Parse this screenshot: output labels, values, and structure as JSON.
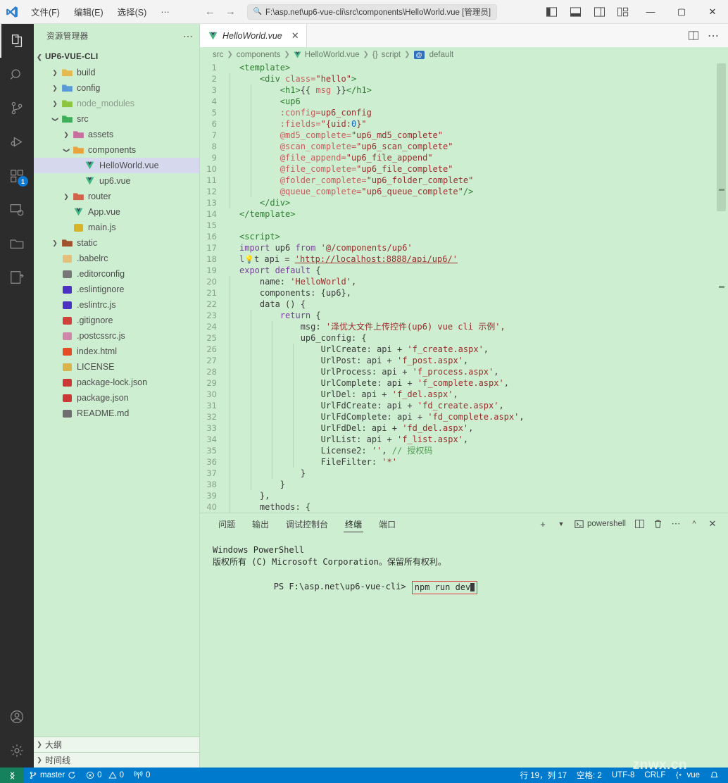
{
  "titlebar": {
    "menus": [
      "文件(F)",
      "编辑(E)",
      "选择(S)",
      "···"
    ],
    "search_path": "F:\\asp.net\\up6-vue-cli\\src\\components\\HelloWorld.vue [管理员]",
    "search_icon": "search-icon",
    "layout_icons": [
      "toggle-primary-sidebar-icon",
      "toggle-panel-icon",
      "toggle-secondary-sidebar-icon",
      "customize-layout-icon"
    ],
    "window_controls": {
      "minimize": "—",
      "maximize": "▢",
      "close": "✕"
    }
  },
  "activity_bar": {
    "items": [
      {
        "name": "explorer",
        "icon": "files-icon",
        "active": true,
        "badge": ""
      },
      {
        "name": "search",
        "icon": "search-icon",
        "active": false,
        "badge": ""
      },
      {
        "name": "source-control",
        "icon": "source-control-icon",
        "active": false,
        "badge": ""
      },
      {
        "name": "run-and-debug",
        "icon": "run-debug-icon",
        "active": false,
        "badge": ""
      },
      {
        "name": "extensions",
        "icon": "extensions-icon",
        "active": false,
        "badge": "1"
      },
      {
        "name": "remote-explorer",
        "icon": "remote-explorer-icon",
        "active": false,
        "badge": ""
      },
      {
        "name": "project-manager",
        "icon": "folder-icon",
        "active": false,
        "badge": ""
      },
      {
        "name": "code-runner",
        "icon": "code-snippet-icon",
        "active": false,
        "badge": ""
      }
    ],
    "bottom": [
      {
        "name": "accounts",
        "icon": "account-icon"
      },
      {
        "name": "manage",
        "icon": "gear-icon"
      }
    ]
  },
  "sidebar": {
    "title": "资源管理器",
    "more_icon": "more-actions-icon",
    "root": "UP6-VUE-CLI",
    "tree": [
      {
        "label": "build",
        "depth": 1,
        "type": "folder",
        "expanded": false,
        "icon": "folder-build-icon",
        "color": "#e6b94e"
      },
      {
        "label": "config",
        "depth": 1,
        "type": "folder",
        "expanded": false,
        "icon": "folder-config-icon",
        "color": "#5a9bd5"
      },
      {
        "label": "node_modules",
        "depth": 1,
        "type": "folder",
        "expanded": false,
        "icon": "folder-node-icon",
        "color": "#8cc63f"
      },
      {
        "label": "src",
        "depth": 1,
        "type": "folder",
        "expanded": true,
        "icon": "folder-src-icon",
        "color": "#3fae5a"
      },
      {
        "label": "assets",
        "depth": 2,
        "type": "folder",
        "expanded": false,
        "icon": "folder-assets-icon",
        "color": "#c96fa0"
      },
      {
        "label": "components",
        "depth": 2,
        "type": "folder",
        "expanded": true,
        "icon": "folder-components-icon",
        "color": "#e8a33d"
      },
      {
        "label": "HelloWorld.vue",
        "depth": 3,
        "type": "file",
        "selected": true,
        "icon": "vue-file-icon",
        "color": "#41b883"
      },
      {
        "label": "up6.vue",
        "depth": 3,
        "type": "file",
        "selected": false,
        "icon": "vue-file-icon",
        "color": "#41b883"
      },
      {
        "label": "router",
        "depth": 2,
        "type": "folder",
        "expanded": false,
        "icon": "folder-router-icon",
        "color": "#d1634b"
      },
      {
        "label": "App.vue",
        "depth": 2,
        "type": "file",
        "selected": false,
        "icon": "vue-file-icon",
        "color": "#41b883"
      },
      {
        "label": "main.js",
        "depth": 2,
        "type": "file",
        "selected": false,
        "icon": "js-file-icon",
        "color": "#d6b429"
      },
      {
        "label": "static",
        "depth": 1,
        "type": "folder",
        "expanded": false,
        "icon": "folder-static-icon",
        "color": "#a0522d"
      },
      {
        "label": ".babelrc",
        "depth": 1,
        "type": "file",
        "selected": false,
        "icon": "babel-file-icon",
        "color": "#e5c07b"
      },
      {
        "label": ".editorconfig",
        "depth": 1,
        "type": "file",
        "selected": false,
        "icon": "editorconfig-file-icon",
        "color": "#777777"
      },
      {
        "label": ".eslintignore",
        "depth": 1,
        "type": "file",
        "selected": false,
        "icon": "eslint-file-icon",
        "color": "#4b32c3"
      },
      {
        "label": ".eslintrc.js",
        "depth": 1,
        "type": "file",
        "selected": false,
        "icon": "eslint-file-icon",
        "color": "#4b32c3"
      },
      {
        "label": ".gitignore",
        "depth": 1,
        "type": "file",
        "selected": false,
        "icon": "git-file-icon",
        "color": "#d1403a"
      },
      {
        "label": ".postcssrc.js",
        "depth": 1,
        "type": "file",
        "selected": false,
        "icon": "postcss-file-icon",
        "color": "#d086a8"
      },
      {
        "label": "index.html",
        "depth": 1,
        "type": "file",
        "selected": false,
        "icon": "html-file-icon",
        "color": "#e44d26"
      },
      {
        "label": "LICENSE",
        "depth": 1,
        "type": "file",
        "selected": false,
        "icon": "license-file-icon",
        "color": "#d8b44a"
      },
      {
        "label": "package-lock.json",
        "depth": 1,
        "type": "file",
        "selected": false,
        "icon": "npm-file-icon",
        "color": "#cb3837"
      },
      {
        "label": "package.json",
        "depth": 1,
        "type": "file",
        "selected": false,
        "icon": "npm-file-icon",
        "color": "#cb3837"
      },
      {
        "label": "README.md",
        "depth": 1,
        "type": "file",
        "selected": false,
        "icon": "markdown-file-icon",
        "color": "#6f6f6f"
      }
    ],
    "sections": [
      {
        "label": "大纲"
      },
      {
        "label": "时间线"
      }
    ]
  },
  "editor": {
    "tab": {
      "label": "HelloWorld.vue",
      "icon": "vue-file-icon",
      "close_icon": "close-icon"
    },
    "tab_actions": [
      "split-editor-icon",
      "more-actions-icon"
    ],
    "breadcrumb": [
      "src",
      "components",
      "HelloWorld.vue",
      "script",
      "default"
    ],
    "breadcrumb_badges": {
      "script": "{}",
      "default": "@"
    },
    "lines": [
      {
        "n": 1,
        "tokens": [
          {
            "t": "<template>",
            "c": "t-tag"
          }
        ],
        "indent": 0
      },
      {
        "n": 2,
        "tokens": [
          {
            "t": "<div ",
            "c": "t-tag"
          },
          {
            "t": "class=",
            "c": "t-attr"
          },
          {
            "t": "\"hello\"",
            "c": "t-str"
          },
          {
            "t": ">",
            "c": "t-tag"
          }
        ],
        "indent": 1
      },
      {
        "n": 3,
        "tokens": [
          {
            "t": "<h1>",
            "c": "t-tag"
          },
          {
            "t": "{{ ",
            "c": "t-punc"
          },
          {
            "t": "msg",
            "c": "t-attr"
          },
          {
            "t": " }}",
            "c": "t-punc"
          },
          {
            "t": "</h1>",
            "c": "t-tag"
          }
        ],
        "indent": 2
      },
      {
        "n": 4,
        "tokens": [
          {
            "t": "<up6",
            "c": "t-tag"
          }
        ],
        "indent": 2
      },
      {
        "n": 5,
        "tokens": [
          {
            "t": ":config=",
            "c": "t-attr"
          },
          {
            "t": "up6_config",
            "c": "t-str"
          }
        ],
        "indent": 2
      },
      {
        "n": 6,
        "tokens": [
          {
            "t": ":fields=",
            "c": "t-attr"
          },
          {
            "t": "\"{uid:",
            "c": "t-str"
          },
          {
            "t": "0",
            "c": "t-num"
          },
          {
            "t": "}\"",
            "c": "t-str"
          }
        ],
        "indent": 2
      },
      {
        "n": 7,
        "tokens": [
          {
            "t": "@md5_complete=",
            "c": "t-attr"
          },
          {
            "t": "\"up6_md5_complete\"",
            "c": "t-str"
          }
        ],
        "indent": 2
      },
      {
        "n": 8,
        "tokens": [
          {
            "t": "@scan_complete=",
            "c": "t-attr"
          },
          {
            "t": "\"up6_scan_complete\"",
            "c": "t-str"
          }
        ],
        "indent": 2
      },
      {
        "n": 9,
        "tokens": [
          {
            "t": "@file_append=",
            "c": "t-attr"
          },
          {
            "t": "\"up6_file_append\"",
            "c": "t-str"
          }
        ],
        "indent": 2
      },
      {
        "n": 10,
        "tokens": [
          {
            "t": "@file_complete=",
            "c": "t-attr"
          },
          {
            "t": "\"up6_file_complete\"",
            "c": "t-str"
          }
        ],
        "indent": 2
      },
      {
        "n": 11,
        "tokens": [
          {
            "t": "@folder_complete=",
            "c": "t-attr"
          },
          {
            "t": "\"up6_folder_complete\"",
            "c": "t-str"
          }
        ],
        "indent": 2
      },
      {
        "n": 12,
        "tokens": [
          {
            "t": "@queue_complete=",
            "c": "t-attr"
          },
          {
            "t": "\"up6_queue_complete\"",
            "c": "t-str"
          },
          {
            "t": "/>",
            "c": "t-tag"
          }
        ],
        "indent": 2
      },
      {
        "n": 13,
        "tokens": [
          {
            "t": "</div>",
            "c": "t-tag"
          }
        ],
        "indent": 1
      },
      {
        "n": 14,
        "tokens": [
          {
            "t": "</template>",
            "c": "t-tag"
          }
        ],
        "indent": 0
      },
      {
        "n": 15,
        "tokens": [],
        "indent": 0
      },
      {
        "n": 16,
        "tokens": [
          {
            "t": "<script>",
            "c": "t-tag"
          }
        ],
        "indent": 0
      },
      {
        "n": 17,
        "tokens": [
          {
            "t": "import",
            "c": "t-kw2"
          },
          {
            "t": " up6 ",
            "c": "t-plain"
          },
          {
            "t": "from",
            "c": "t-kw2"
          },
          {
            "t": " '@/components/up6'",
            "c": "t-str"
          }
        ],
        "indent": 0
      },
      {
        "n": 18,
        "tokens": [
          {
            "t": "l",
            "c": "t-kw2"
          },
          {
            "t": "💡",
            "c": "bulb"
          },
          {
            "t": "t api = ",
            "c": "t-plain"
          },
          {
            "t": "'http://localhost:8888/api/up6/'",
            "c": "t-link"
          }
        ],
        "indent": 0
      },
      {
        "n": 19,
        "tokens": [
          {
            "t": "export default",
            "c": "t-kw2"
          },
          {
            "t": " {",
            "c": "t-punc"
          }
        ],
        "indent": 0
      },
      {
        "n": 20,
        "tokens": [
          {
            "t": "name: ",
            "c": "t-plain"
          },
          {
            "t": "'HelloWorld'",
            "c": "t-str"
          },
          {
            "t": ",",
            "c": "t-punc"
          }
        ],
        "indent": 1
      },
      {
        "n": 21,
        "tokens": [
          {
            "t": "components: {up6},",
            "c": "t-plain"
          }
        ],
        "indent": 1
      },
      {
        "n": 22,
        "tokens": [
          {
            "t": "data () {",
            "c": "t-plain"
          }
        ],
        "indent": 1
      },
      {
        "n": 23,
        "tokens": [
          {
            "t": "return",
            "c": "t-kw2"
          },
          {
            "t": " {",
            "c": "t-punc"
          }
        ],
        "indent": 2
      },
      {
        "n": 24,
        "tokens": [
          {
            "t": "msg: ",
            "c": "t-plain"
          },
          {
            "t": "'泽优大文件上传控件(up6) vue cli 示例',",
            "c": "t-str"
          }
        ],
        "indent": 3
      },
      {
        "n": 25,
        "tokens": [
          {
            "t": "up6_config: {",
            "c": "t-plain"
          }
        ],
        "indent": 3
      },
      {
        "n": 26,
        "tokens": [
          {
            "t": "UrlCreate: api + ",
            "c": "t-plain"
          },
          {
            "t": "'f_create.aspx'",
            "c": "t-str"
          },
          {
            "t": ",",
            "c": "t-punc"
          }
        ],
        "indent": 4
      },
      {
        "n": 27,
        "tokens": [
          {
            "t": "UrlPost: api + ",
            "c": "t-plain"
          },
          {
            "t": "'f_post.aspx'",
            "c": "t-str"
          },
          {
            "t": ",",
            "c": "t-punc"
          }
        ],
        "indent": 4
      },
      {
        "n": 28,
        "tokens": [
          {
            "t": "UrlProcess: api + ",
            "c": "t-plain"
          },
          {
            "t": "'f_process.aspx'",
            "c": "t-str"
          },
          {
            "t": ",",
            "c": "t-punc"
          }
        ],
        "indent": 4
      },
      {
        "n": 29,
        "tokens": [
          {
            "t": "UrlComplete: api + ",
            "c": "t-plain"
          },
          {
            "t": "'f_complete.aspx'",
            "c": "t-str"
          },
          {
            "t": ",",
            "c": "t-punc"
          }
        ],
        "indent": 4
      },
      {
        "n": 30,
        "tokens": [
          {
            "t": "UrlDel: api + ",
            "c": "t-plain"
          },
          {
            "t": "'f_del.aspx'",
            "c": "t-str"
          },
          {
            "t": ",",
            "c": "t-punc"
          }
        ],
        "indent": 4
      },
      {
        "n": 31,
        "tokens": [
          {
            "t": "UrlFdCreate: api + ",
            "c": "t-plain"
          },
          {
            "t": "'fd_create.aspx'",
            "c": "t-str"
          },
          {
            "t": ",",
            "c": "t-punc"
          }
        ],
        "indent": 4
      },
      {
        "n": 32,
        "tokens": [
          {
            "t": "UrlFdComplete: api + ",
            "c": "t-plain"
          },
          {
            "t": "'fd_complete.aspx'",
            "c": "t-str"
          },
          {
            "t": ",",
            "c": "t-punc"
          }
        ],
        "indent": 4
      },
      {
        "n": 33,
        "tokens": [
          {
            "t": "UrlFdDel: api + ",
            "c": "t-plain"
          },
          {
            "t": "'fd_del.aspx'",
            "c": "t-str"
          },
          {
            "t": ",",
            "c": "t-punc"
          }
        ],
        "indent": 4
      },
      {
        "n": 34,
        "tokens": [
          {
            "t": "UrlList: api + ",
            "c": "t-plain"
          },
          {
            "t": "'f_list.aspx'",
            "c": "t-str"
          },
          {
            "t": ",",
            "c": "t-punc"
          }
        ],
        "indent": 4
      },
      {
        "n": 35,
        "tokens": [
          {
            "t": "License2: ",
            "c": "t-plain"
          },
          {
            "t": "''",
            "c": "t-str"
          },
          {
            "t": ", ",
            "c": "t-punc"
          },
          {
            "t": "// 授权码",
            "c": "t-com"
          }
        ],
        "indent": 4
      },
      {
        "n": 36,
        "tokens": [
          {
            "t": "FileFilter: ",
            "c": "t-plain"
          },
          {
            "t": "'*'",
            "c": "t-str"
          }
        ],
        "indent": 4
      },
      {
        "n": 37,
        "tokens": [
          {
            "t": "}",
            "c": "t-punc"
          }
        ],
        "indent": 3
      },
      {
        "n": 38,
        "tokens": [
          {
            "t": "}",
            "c": "t-punc"
          }
        ],
        "indent": 2
      },
      {
        "n": 39,
        "tokens": [
          {
            "t": "},",
            "c": "t-punc"
          }
        ],
        "indent": 1
      },
      {
        "n": 40,
        "tokens": [
          {
            "t": "methods: {",
            "c": "t-plain"
          }
        ],
        "indent": 1
      }
    ]
  },
  "panel": {
    "tabs": [
      {
        "label": "问题",
        "active": false
      },
      {
        "label": "输出",
        "active": false
      },
      {
        "label": "调试控制台",
        "active": false
      },
      {
        "label": "终端",
        "active": true
      },
      {
        "label": "端口",
        "active": false
      }
    ],
    "actions": {
      "new_terminal_icon": "plus-icon",
      "dropdown_icon": "chevron-down-icon",
      "shell_icon": "terminal-icon",
      "shell_label": "powershell",
      "split_icon": "split-terminal-icon",
      "kill_icon": "trash-icon",
      "more_icon": "more-actions-icon",
      "maximize_icon": "chevron-up-icon",
      "close_icon": "close-icon"
    },
    "terminal": {
      "lines": [
        "Windows PowerShell",
        "版权所有 (C) Microsoft Corporation。保留所有权利。",
        ""
      ],
      "prompt": "PS F:\\asp.net\\up6-vue-cli> ",
      "command": "npm run dev"
    }
  },
  "status_bar": {
    "remote_icon": "remote-indicator-icon",
    "branch_icon": "source-control-icon",
    "branch": "master",
    "sync_icon": "sync-icon",
    "errors_icon": "error-icon",
    "errors": "0",
    "warnings_icon": "warning-icon",
    "warnings": "0",
    "radio_icon": "radio-tower-icon",
    "ports": "0",
    "cursor": "行 19，列 17",
    "spaces": "空格: 2",
    "encoding": "UTF-8",
    "eol": "CRLF",
    "language_icon": "vue-lang-icon",
    "language": "vue",
    "bell_icon": "bell-icon"
  },
  "watermark": "znwx.cn"
}
